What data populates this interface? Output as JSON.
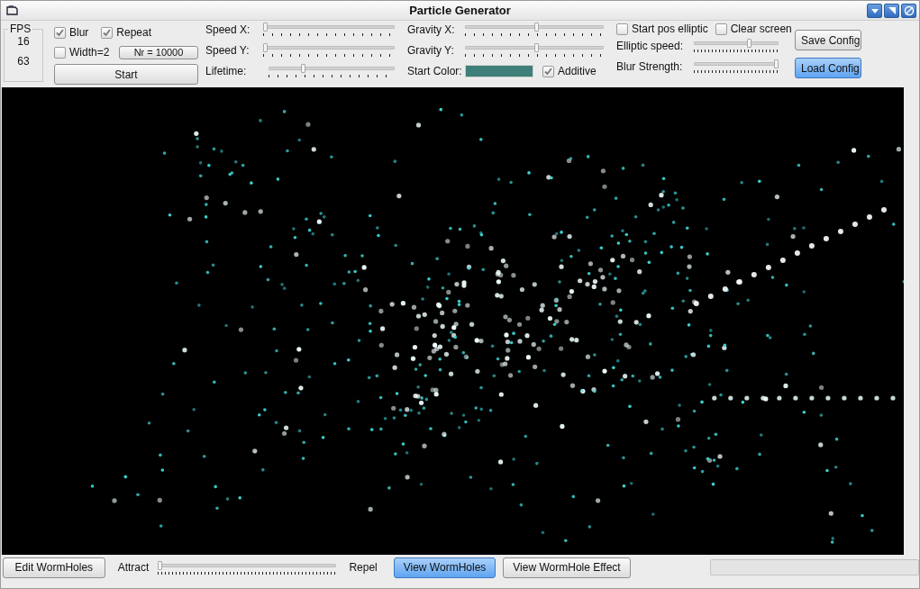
{
  "window": {
    "title": "Particle Generator"
  },
  "fps_group": {
    "title": "FPS",
    "readings": [
      "16",
      "63"
    ]
  },
  "options": {
    "blur": {
      "label": "Blur",
      "checked": true
    },
    "repeat": {
      "label": "Repeat",
      "checked": true
    },
    "width2": {
      "label": "Width=2",
      "checked": false
    },
    "count_button": "Nr = 10000",
    "start_button": "Start"
  },
  "motion_sliders": [
    {
      "label": "Speed X:",
      "level": 0
    },
    {
      "label": "Speed Y:",
      "level": 0
    },
    {
      "label": "Lifetime:",
      "level": 0.27
    }
  ],
  "gravity_sliders": [
    {
      "label": "Gravity X:",
      "level": 0.52
    },
    {
      "label": "Gravity Y:",
      "level": 0.52
    }
  ],
  "start_color": {
    "label": "Start Color:",
    "color": "#3f7f7a"
  },
  "additive": {
    "label": "Additive",
    "checked": true
  },
  "elliptic": {
    "start_pos": {
      "label": "Start pos elliptic",
      "checked": false
    },
    "clear_screen": {
      "label": "Clear screen",
      "checked": false
    }
  },
  "effect_sliders": [
    {
      "label": "Elliptic speed:",
      "level": 0.66
    },
    {
      "label": "Blur Strength:",
      "level": 1
    }
  ],
  "config_buttons": [
    {
      "label": "Save Config",
      "selected": false
    },
    {
      "label": "Load Config",
      "selected": true
    }
  ],
  "bottom": {
    "edit_button": "Edit WormHoles",
    "attract_label": "Attract",
    "attract_slider": {
      "level": 0
    },
    "repel_label": "Repel",
    "view_buttons": [
      {
        "label": "View WormHoles",
        "selected": true
      },
      {
        "label": "View WormHole Effect",
        "selected": false
      }
    ],
    "progress": {
      "level": 0
    }
  }
}
